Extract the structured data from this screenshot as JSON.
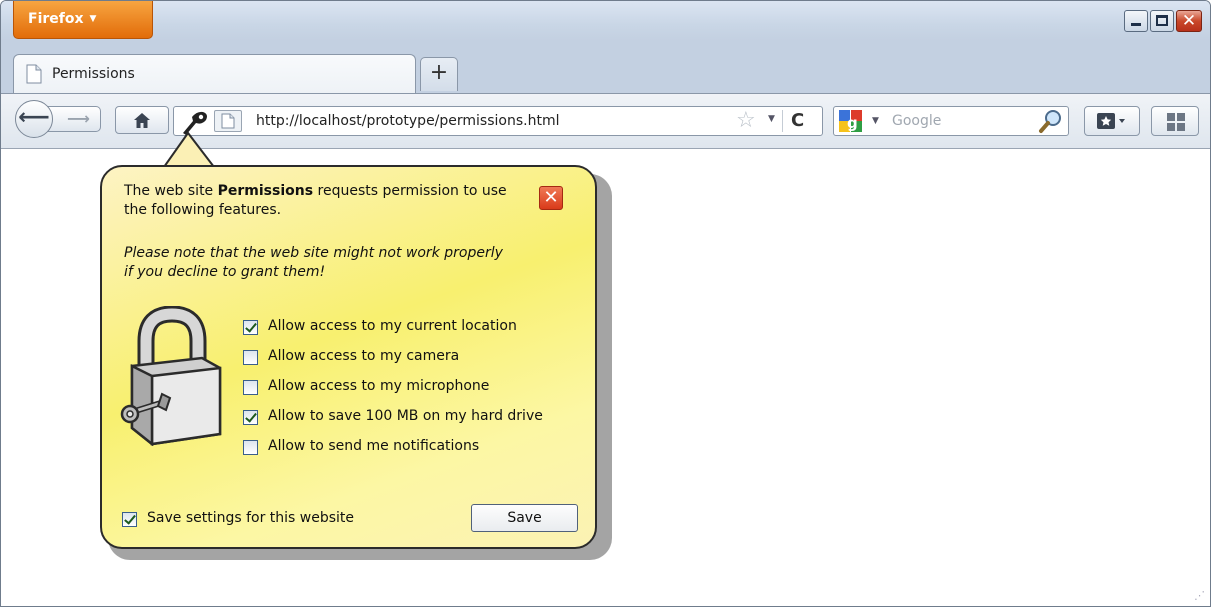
{
  "app_menu": {
    "label": "Firefox",
    "arrow": "▼"
  },
  "window_controls": {
    "minimize": "",
    "maximize": "",
    "close": "✕"
  },
  "tabs": [
    {
      "title": "Permissions",
      "icon": "page-icon"
    }
  ],
  "new_tab": {
    "label": "+"
  },
  "navbar": {
    "back": "⟵",
    "forward": "⟶",
    "url": "http://localhost/prototype/permissions.html",
    "reload": "C",
    "search_placeholder": "Google"
  },
  "popup": {
    "intro_before": "The web site ",
    "site_name": "Permissions",
    "intro_after": " requests permission to use the following features.",
    "note": "Please note that the web site might not work properly if you decline to grant them!",
    "close": "✕",
    "permissions": [
      {
        "label": "Allow access to my current location",
        "checked": true
      },
      {
        "label": "Allow access to my camera",
        "checked": false
      },
      {
        "label": "Allow access to my microphone",
        "checked": false
      },
      {
        "label": "Allow to save 100 MB on my hard drive",
        "checked": true
      },
      {
        "label": "Allow to send me notifications",
        "checked": false
      }
    ],
    "save_settings": {
      "label": "Save settings for this website",
      "checked": true
    },
    "save_button": "Save"
  },
  "colors": {
    "firefox_orange": "#e26c09",
    "popup_yellow": "#f8f06f",
    "close_red": "#d93a1a"
  }
}
